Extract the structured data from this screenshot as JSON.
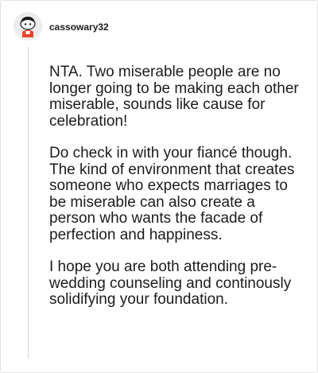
{
  "comment": {
    "username": "cassowary32",
    "avatar_icon": "snoo-avatar-icon",
    "paragraphs": [
      "NTA. Two miserable people are no longer going to be making each other miserable, sounds like cause for celebration!",
      "Do check in with your fiancé though. The kind of environment that creates someone who expects marriages to be miserable can also create a person who wants the facade of perfection and happiness.",
      "I hope you are both attending pre-wedding counseling and continously solidifying your foundation."
    ]
  },
  "colors": {
    "text": "#1c1c1c",
    "avatar_body": "#e8462b",
    "thread_line": "#d6d6d6"
  }
}
